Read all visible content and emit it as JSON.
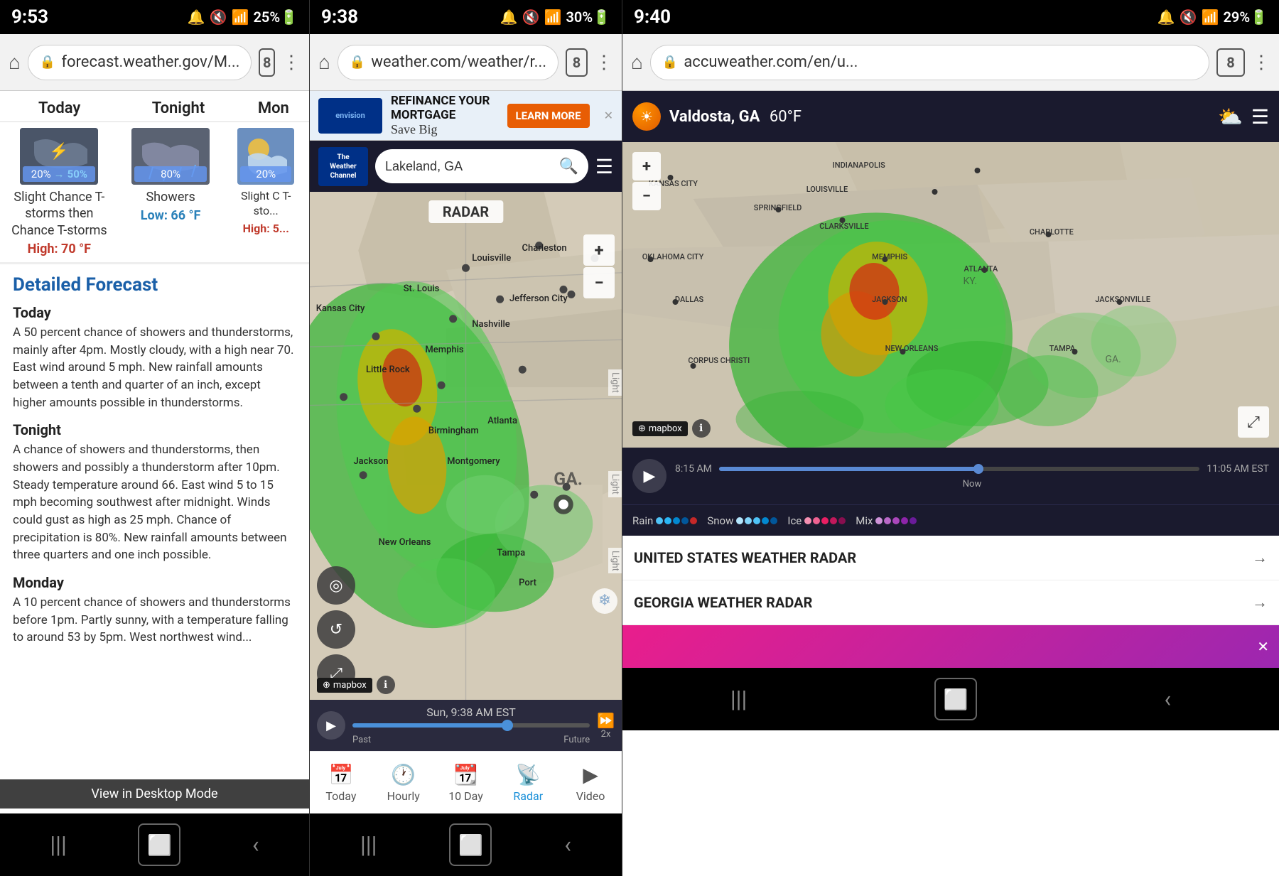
{
  "panels": [
    {
      "id": "panel-forecast-gov",
      "statusBar": {
        "time": "9:53",
        "icons": "🔔 🔇 ⊡ 📶 25%🔋"
      },
      "browserBar": {
        "url": "forecast.weather.gov/M...",
        "tabCount": "8"
      },
      "header": {
        "cols": [
          "Today",
          "Tonight",
          "Mon"
        ]
      },
      "weatherCards": [
        {
          "type": "thunderstorm",
          "precipFrom": "20%",
          "precipTo": "50%",
          "desc": "Slight Chance T-storms then Chance T-storms",
          "tempLabel": "High: 70 °F",
          "tempType": "high"
        },
        {
          "type": "rain",
          "precip": "80%",
          "desc": "Showers",
          "tempLabel": "Low: 66 °F",
          "tempType": "low"
        },
        {
          "type": "partly-cloudy",
          "precip": "20%",
          "desc": "Slight C T-sto...",
          "tempLabel": "High: 5...",
          "tempType": "high"
        }
      ],
      "detailedForecast": {
        "title": "Detailed Forecast",
        "periods": [
          {
            "name": "Today",
            "text": "A 50 percent chance of showers and thunderstorms, mainly after 4pm. Mostly cloudy, with a high near 70. East wind around 5 mph. New rainfall amounts between a tenth and quarter of an inch, except higher amounts possible in thunderstorms."
          },
          {
            "name": "Tonight",
            "text": "A chance of showers and thunderstorms, then showers and possibly a thunderstorm after 10pm. Steady temperature around 66. East wind 5 to 15 mph becoming southwest after midnight. Winds could gust as high as 25 mph. Chance of precipitation is 80%. New rainfall amounts between three quarters and one inch possible."
          },
          {
            "name": "Monday",
            "text": "A 10 percent chance of showers and thunderstorms before 1pm. Partly sunny, with a temperature falling to around 53 by 5pm. West northwest wind..."
          }
        ]
      },
      "viewDesktop": "View in Desktop Mode"
    },
    {
      "id": "panel-weather-com",
      "statusBar": {
        "time": "9:38",
        "icons": "🔔 🔇 📶 30%🔋"
      },
      "browserBar": {
        "url": "weather.com/weather/r...",
        "tabCount": "8"
      },
      "ad": {
        "logoText": "envision",
        "headline": "REFINANCE YOUR MORTGAGE",
        "subline": "Save Big",
        "cta": "LEARN MORE"
      },
      "appBar": {
        "logoLine1": "The",
        "logoLine2": "Weather",
        "logoLine3": "Channel",
        "searchValue": "Lakeland, GA"
      },
      "radarLabel": "RADAR",
      "mapCities": [
        {
          "name": "Kansas City",
          "left": "9%",
          "top": "22%"
        },
        {
          "name": "St. Louis",
          "left": "28%",
          "top": "20%"
        },
        {
          "name": "Louisville",
          "left": "52%",
          "top": "14%"
        },
        {
          "name": "Charleston",
          "left": "72%",
          "top": "12%"
        },
        {
          "name": "Little Rock",
          "left": "20%",
          "top": "36%"
        },
        {
          "name": "Memphis",
          "left": "38%",
          "top": "33%"
        },
        {
          "name": "Nashville",
          "left": "53%",
          "top": "28%"
        },
        {
          "name": "Jefferson City",
          "left": "64%",
          "top": "22%"
        },
        {
          "name": "Birmingham",
          "left": "40%",
          "top": "48%"
        },
        {
          "name": "Atlanta",
          "left": "58%",
          "top": "46%"
        },
        {
          "name": "Jackson",
          "left": "24%",
          "top": "53%"
        },
        {
          "name": "Montgomery",
          "left": "47%",
          "top": "55%"
        },
        {
          "name": "New Orleans",
          "left": "27%",
          "top": "70%"
        },
        {
          "name": "Tampa",
          "left": "62%",
          "top": "72%"
        },
        {
          "name": "Port",
          "left": "70%",
          "top": "78%"
        }
      ],
      "timeline": {
        "playLabel": "▶",
        "timeLabel": "Sun, 9:38 AM EST",
        "pastLabel": "Past",
        "futureLabel": "Future",
        "ffLabel": "2x"
      },
      "navItems": [
        {
          "label": "Today",
          "icon": "📅",
          "active": false
        },
        {
          "label": "Hourly",
          "icon": "🕐",
          "active": false
        },
        {
          "label": "10 Day",
          "icon": "📆",
          "active": false
        },
        {
          "label": "Radar",
          "icon": "📡",
          "active": true
        },
        {
          "label": "Video",
          "icon": "▶",
          "active": false
        }
      ]
    },
    {
      "id": "panel-accuweather",
      "statusBar": {
        "time": "9:40",
        "icons": "🔔 🔇 📶 29%🔋"
      },
      "browserBar": {
        "url": "accuweather.com/en/u...",
        "tabCount": "8"
      },
      "header": {
        "city": "Valdosta, GA",
        "temp": "60°F"
      },
      "timeline": {
        "startTime": "8:15 AM",
        "endTime": "11:05 AM EST",
        "nowLabel": "Now"
      },
      "legend": [
        {
          "label": "Rain",
          "colors": [
            "#4fc3f7",
            "#29b6f6",
            "#0288d1",
            "#01579b",
            "#c62828"
          ]
        },
        {
          "label": "Snow",
          "colors": [
            "#b3e5fc",
            "#81d4fa",
            "#4fc3f7",
            "#0288d1",
            "#01579b"
          ]
        },
        {
          "label": "Ice",
          "colors": [
            "#f48fb1",
            "#f06292",
            "#e91e63",
            "#c2185b",
            "#880e4f"
          ]
        },
        {
          "label": "Mix",
          "colors": [
            "#ce93d8",
            "#ba68c8",
            "#ab47bc",
            "#8e24aa",
            "#6a1b9a"
          ]
        }
      ],
      "radarLinks": [
        {
          "label": "UNITED STATES WEATHER RADAR"
        },
        {
          "label": "GEORGIA WEATHER RADAR"
        }
      ],
      "mapCities": [
        {
          "name": "INDIANAPOLIS",
          "left": "32%",
          "top": "8%"
        },
        {
          "name": "LOUISVILLE",
          "left": "28%",
          "top": "16%"
        },
        {
          "name": "SPRINGFIELD",
          "left": "20%",
          "top": "22%"
        },
        {
          "name": "CLARKSVILLE",
          "left": "30%",
          "top": "28%"
        },
        {
          "name": "KANSAS CITY",
          "left": "4%",
          "top": "14%"
        },
        {
          "name": "OKLAHOMA CITY",
          "left": "4%",
          "top": "38%"
        },
        {
          "name": "MEMPHIS",
          "left": "38%",
          "top": "38%"
        },
        {
          "name": "DALLAS",
          "left": "8%",
          "top": "52%"
        },
        {
          "name": "JACKSON",
          "left": "38%",
          "top": "52%"
        },
        {
          "name": "ATLANTA",
          "left": "52%",
          "top": "42%"
        },
        {
          "name": "CHARLOTTE",
          "left": "62%",
          "top": "30%"
        },
        {
          "name": "JACKSONVILLE",
          "left": "72%",
          "top": "52%"
        },
        {
          "name": "NEW ORLEANS",
          "left": "40%",
          "top": "68%"
        },
        {
          "name": "TAMPA",
          "left": "65%",
          "top": "68%"
        },
        {
          "name": "CORPUS CHRISTI",
          "left": "10%",
          "top": "72%"
        }
      ]
    }
  ]
}
